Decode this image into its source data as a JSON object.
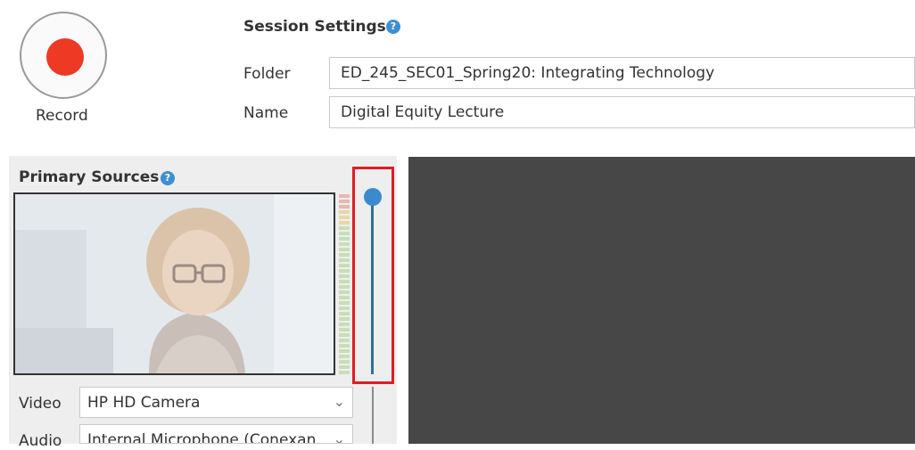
{
  "record": {
    "label": "Record",
    "color": "#ee3a24"
  },
  "session": {
    "title": "Session Settings",
    "help_icon": "?",
    "folder_label": "Folder",
    "folder_value": "ED_245_SEC01_Spring20: Integrating Technology",
    "name_label": "Name",
    "name_value": "Digital Equity Lecture"
  },
  "primary_sources": {
    "title": "Primary Sources",
    "help_icon": "?",
    "video_label": "Video",
    "video_value": "HP HD Camera",
    "audio_label": "Audio",
    "audio_value": "Internal Microphone (Conexan",
    "volume_level": 1.0
  },
  "colors": {
    "accent": "#3b8ad0",
    "highlight": "#e31b23",
    "preview_bg": "#474747"
  }
}
